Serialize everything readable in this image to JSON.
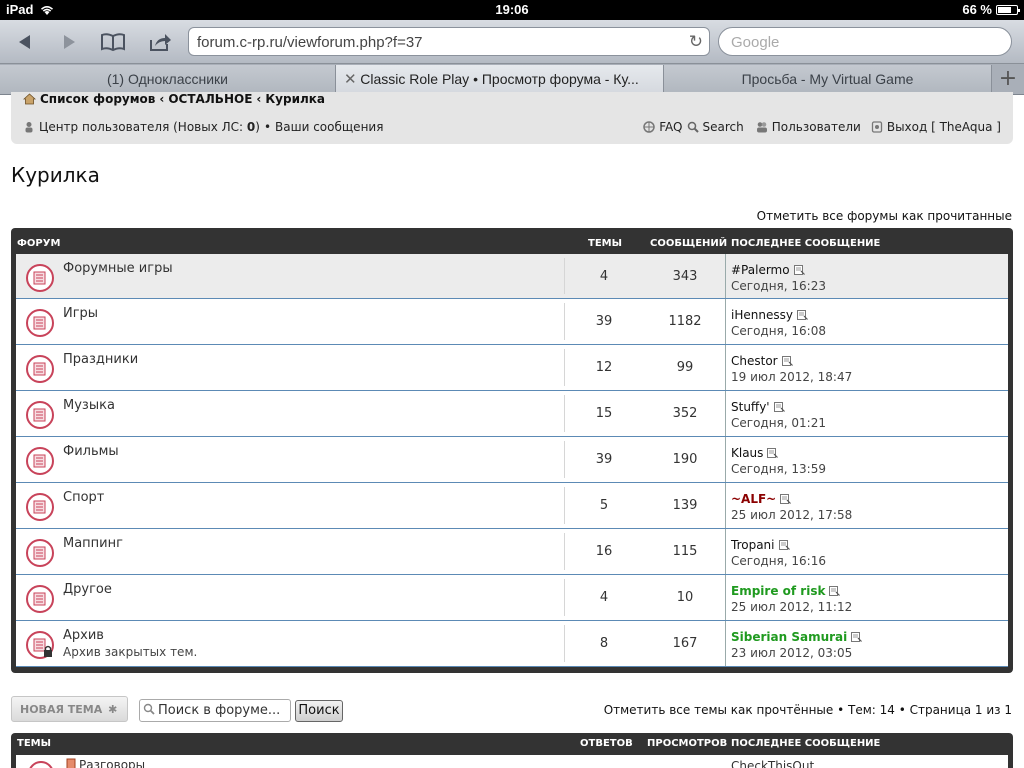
{
  "status": {
    "device": "iPad",
    "time": "19:06",
    "battery": "66 %"
  },
  "browser": {
    "url": "forum.c-rp.ru/viewforum.php?f=37",
    "search_placeholder": "Google",
    "tabs": [
      {
        "label": "(1) Одноклассники",
        "active": false
      },
      {
        "label": "Classic Role Play • Просмотр форума - Ку...",
        "active": true
      },
      {
        "label": "Просьба - My Virtual Game",
        "active": false
      }
    ],
    "add_tab": "+"
  },
  "nav": {
    "breadcrumb": [
      "Список форумов",
      "ОСТАЛЬНОЕ",
      "Курилка"
    ],
    "crumb_sep": "‹",
    "ucp_prefix": "Центр пользователя (Новых ЛС: ",
    "ucp_count": "0",
    "ucp_suffix": ")",
    "bullet": "•",
    "my_posts": "Ваши сообщения",
    "faq": "FAQ",
    "search": "Search",
    "members": "Пользователи",
    "logout": "Выход [ TheAqua ]"
  },
  "page": {
    "title": "Курилка",
    "mark_forums_read": "Отметить все форумы как прочитанные"
  },
  "forum_table": {
    "headers": {
      "forum": "ФОРУМ",
      "topics": "ТЕМЫ",
      "posts": "СООБЩЕНИЙ",
      "last_post": "ПОСЛЕДНЕЕ СООБЩЕНИЕ"
    },
    "rows": [
      {
        "name": "Форумные игры",
        "desc": "",
        "topics": "4",
        "posts": "343",
        "user": "#Palermo",
        "user_color": "#111111",
        "bold": false,
        "date": "Сегодня, 16:23"
      },
      {
        "name": "Игры",
        "desc": "",
        "topics": "39",
        "posts": "1182",
        "user": "iHennessy",
        "user_color": "#111111",
        "bold": false,
        "date": "Сегодня, 16:08"
      },
      {
        "name": "Праздники",
        "desc": "",
        "topics": "12",
        "posts": "99",
        "user": "Chestor",
        "user_color": "#111111",
        "bold": false,
        "date": "19 июл 2012, 18:47"
      },
      {
        "name": "Музыка",
        "desc": "",
        "topics": "15",
        "posts": "352",
        "user": "Stuffy'",
        "user_color": "#111111",
        "bold": false,
        "date": "Сегодня, 01:21"
      },
      {
        "name": "Фильмы",
        "desc": "",
        "topics": "39",
        "posts": "190",
        "user": "Klaus",
        "user_color": "#111111",
        "bold": false,
        "date": "Сегодня, 13:59"
      },
      {
        "name": "Спорт",
        "desc": "",
        "topics": "5",
        "posts": "139",
        "user": "~ALF~",
        "user_color": "#8b0000",
        "bold": true,
        "date": "25 июл 2012, 17:58"
      },
      {
        "name": "Маппинг",
        "desc": "",
        "topics": "16",
        "posts": "115",
        "user": "Tropani",
        "user_color": "#111111",
        "bold": false,
        "date": "Сегодня, 16:16"
      },
      {
        "name": "Другое",
        "desc": "",
        "topics": "4",
        "posts": "10",
        "user": "Empire of risk",
        "user_color": "#1f9a1f",
        "bold": true,
        "date": "25 июл 2012, 11:12"
      },
      {
        "name": "Архив",
        "desc": "Архив закрытых тем.",
        "topics": "8",
        "posts": "167",
        "user": "Siberian Samurai",
        "user_color": "#1f9a1f",
        "bold": true,
        "date": "23 июл 2012, 03:05"
      }
    ]
  },
  "actions": {
    "new_topic": "НОВАЯ ТЕМА",
    "search_placeholder": "Поиск в форуме...",
    "search_button": "Поиск",
    "pagination": "Отметить все темы как прочтённые • Тем: 14 • Страница 1 из 1"
  },
  "topics_table": {
    "headers": {
      "topics": "ТЕМЫ",
      "replies": "ОТВЕТОВ",
      "views": "ПРОСМОТРОВ",
      "last_post": "ПОСЛЕДНЕЕ СООБЩЕНИЕ"
    },
    "first_row": {
      "name": "Разговоры",
      "user": "CheckThisOut"
    }
  },
  "colors": {
    "accent_blue": "#5c8ab5",
    "forum_icon_red": "#c8435a",
    "dark_header": "#333333"
  },
  "icons": {
    "back": "back-icon",
    "forward": "forward-icon",
    "bookmarks": "bookmarks-icon",
    "share": "share-icon",
    "reload": "reload-icon"
  }
}
